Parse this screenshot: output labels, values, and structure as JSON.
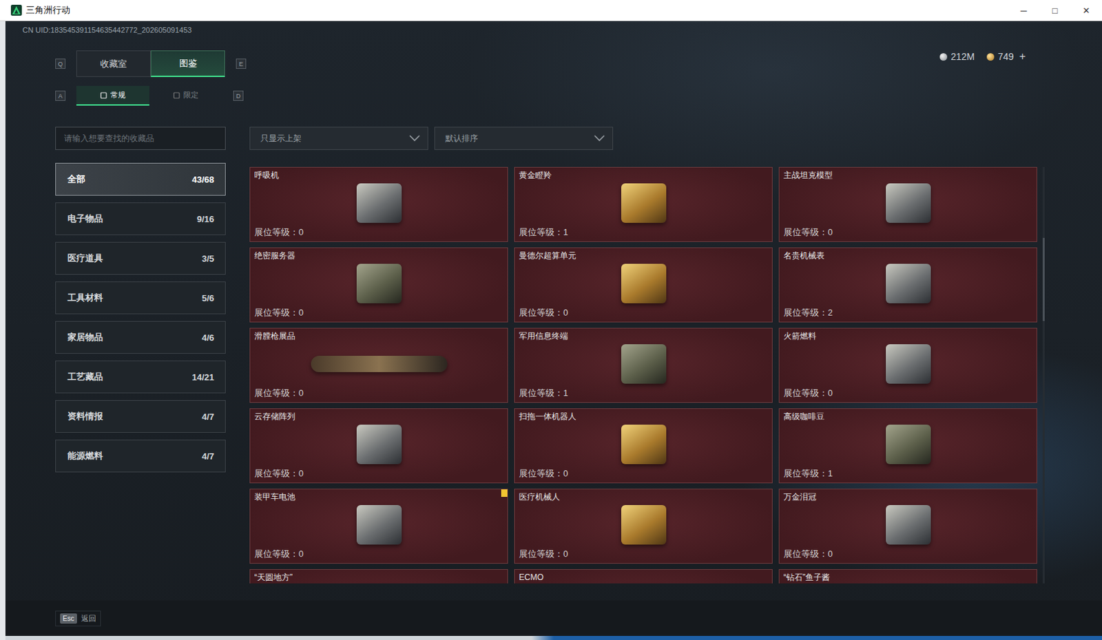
{
  "window": {
    "title": "三角洲行动",
    "controls": [
      "─",
      "□",
      "✕"
    ]
  },
  "uid": "CN UID:183545391154635442772_202605091453",
  "currency": [
    {
      "amount": "212M",
      "kind": "silver"
    },
    {
      "amount": "749",
      "kind": "gold"
    }
  ],
  "add_button": "+",
  "tab_keys": [
    "Q",
    "E"
  ],
  "tabs": [
    {
      "label": "收藏室",
      "selected": false
    },
    {
      "label": "图鉴",
      "selected": true
    }
  ],
  "subtab_keys": [
    "A",
    "D"
  ],
  "subtabs": [
    {
      "label": "常规",
      "selected": true
    },
    {
      "label": "限定",
      "selected": false
    }
  ],
  "search": {
    "placeholder": "请输入想要查找的收藏品"
  },
  "filters": [
    {
      "label": "只显示上架"
    },
    {
      "label": "默认排序"
    }
  ],
  "sidebar": {
    "items": [
      {
        "label": "全部",
        "count": "43/68",
        "selected": true
      },
      {
        "label": "电子物品",
        "count": "9/16",
        "selected": false
      },
      {
        "label": "医疗道具",
        "count": "3/5",
        "selected": false
      },
      {
        "label": "工具材料",
        "count": "5/6",
        "selected": false
      },
      {
        "label": "家居物品",
        "count": "4/6",
        "selected": false
      },
      {
        "label": "工艺藏品",
        "count": "14/21",
        "selected": false
      },
      {
        "label": "资料情报",
        "count": "4/7",
        "selected": false
      },
      {
        "label": "能源燃料",
        "count": "4/7",
        "selected": false
      }
    ]
  },
  "grid": {
    "level_label": "展位等级：",
    "items": [
      {
        "name": "呼吸机",
        "level": "0",
        "marked": false
      },
      {
        "name": "黄金瞪羚",
        "level": "1",
        "marked": false
      },
      {
        "name": "主战坦克模型",
        "level": "0",
        "marked": false
      },
      {
        "name": "绝密服务器",
        "level": "0",
        "marked": false
      },
      {
        "name": "曼德尔超算单元",
        "level": "0",
        "marked": false
      },
      {
        "name": "名贵机械表",
        "level": "2",
        "marked": false
      },
      {
        "name": "滑膛枪展品",
        "level": "0",
        "marked": false
      },
      {
        "name": "军用信息终端",
        "level": "1",
        "marked": false
      },
      {
        "name": "火箭燃料",
        "level": "0",
        "marked": false
      },
      {
        "name": "云存储阵列",
        "level": "0",
        "marked": false
      },
      {
        "name": "扫拖一体机器人",
        "level": "0",
        "marked": false
      },
      {
        "name": "高级咖啡豆",
        "level": "1",
        "marked": false
      },
      {
        "name": "装甲车电池",
        "level": "0",
        "marked": true
      },
      {
        "name": "医疗机械人",
        "level": "0",
        "marked": false
      },
      {
        "name": "万金泪冠",
        "level": "0",
        "marked": false
      },
      {
        "name": "“天圆地方”",
        "marked": false
      },
      {
        "name": "ECMO",
        "marked": false
      },
      {
        "name": "“钻石”鱼子酱",
        "marked": false
      }
    ]
  },
  "scrollbar": {
    "start": 0.17,
    "size": 0.2
  },
  "footer": {
    "key": "Esc",
    "label": "返回"
  }
}
